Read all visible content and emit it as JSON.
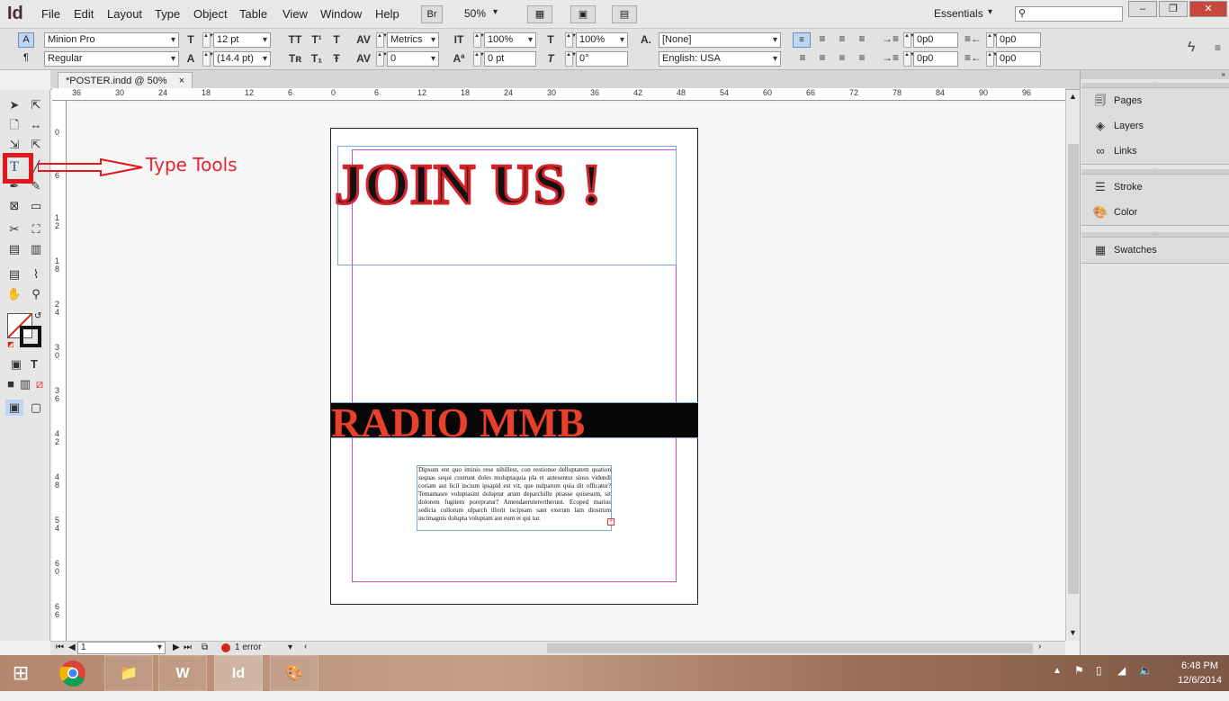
{
  "app": {
    "logo": "Id",
    "workspace": "Essentials",
    "search_placeholder": ""
  },
  "menu": [
    "File",
    "Edit",
    "Layout",
    "Type",
    "Object",
    "Table",
    "View",
    "Window",
    "Help"
  ],
  "toolbar_mini": {
    "bridge": "Br",
    "zoom": "50%"
  },
  "control": {
    "font_family": "Minion Pro",
    "font_style": "Regular",
    "font_size": "12 pt",
    "leading": "(14.4 pt)",
    "kerning": "Metrics",
    "tracking": "0",
    "vscale": "100%",
    "hscale": "100%",
    "baseline": "0 pt",
    "skew": "0°",
    "char_style": "[None]",
    "language": "English: USA",
    "left_indent": "0p0",
    "right_indent": "0p0",
    "first_indent": "0p0",
    "last_indent": "0p0",
    "space_before": "0p0",
    "space_after": "0p0",
    "drop_cap": "0p0"
  },
  "document_tab": "*POSTER.indd @ 50%",
  "ruler_h": [
    "36",
    "30",
    "24",
    "18",
    "12",
    "6",
    "0",
    "6",
    "12",
    "18",
    "24",
    "30",
    "36",
    "42",
    "48",
    "54",
    "60",
    "66",
    "72",
    "78",
    "84",
    "90",
    "96"
  ],
  "ruler_v": [
    "0",
    "6",
    "1 2",
    "1 8",
    "2 4",
    "3 0",
    "3 6",
    "4 2",
    "4 8",
    "5 4",
    "6 0",
    "6 6"
  ],
  "poster": {
    "headline": "JOIN US !",
    "banner": "RADIO MMB",
    "body": "Dipsum ent quo iminis rese nihillest, con restionse delluptatem quation sequas sequi custrunt doles moluptaquia pla et autesentur sinus videndi coriam aut licil incium ipsapid est vit, que nulparum quia dit officatur? Temamasre voluptasint doluptur arum deparchillu ptiasse quisesum, sit dolorem fugitem porepratur? Amendaeruterertherunt. Ecoped marius sedicia cullorum ulparch illorit iscipsam sant exerum lam diostrum incimagnis dolupta voluptam aut eum et qui tur."
  },
  "annotation": {
    "label": "Type Tools",
    "color": "#e8232a"
  },
  "panels": [
    {
      "items": [
        {
          "icon": "pages-icon",
          "label": "Pages"
        },
        {
          "icon": "layers-icon",
          "label": "Layers"
        },
        {
          "icon": "links-icon",
          "label": "Links"
        }
      ]
    },
    {
      "items": [
        {
          "icon": "stroke-icon",
          "label": "Stroke"
        },
        {
          "icon": "color-icon",
          "label": "Color"
        }
      ]
    },
    {
      "items": [
        {
          "icon": "swatches-icon",
          "label": "Swatches"
        }
      ]
    }
  ],
  "status": {
    "page": "1",
    "errors": "1 error"
  },
  "taskbar": {
    "time": "6:48 PM",
    "date": "12/6/2014",
    "apps": [
      "chrome-icon",
      "file-explorer-icon",
      "word-icon",
      "indesign-icon",
      "paint-icon"
    ]
  },
  "colors": {
    "headline_stroke": "#d3232a",
    "banner_text": "#e8402a",
    "margin_guide": "#c64ec6",
    "frame_edge": "#7aa7d6"
  }
}
